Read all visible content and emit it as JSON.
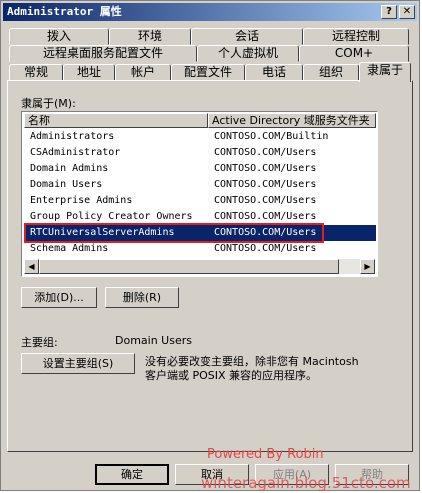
{
  "window": {
    "title": "Administrator 属性",
    "help_btn": "?",
    "close_btn": "✕"
  },
  "tabs": {
    "row1": [
      "拨入",
      "环境",
      "会话",
      "远程控制"
    ],
    "row2": [
      "远程桌面服务配置文件",
      "个人虚拟机",
      "COM+"
    ],
    "row3": [
      "常规",
      "地址",
      "帐户",
      "配置文件",
      "电话",
      "组织",
      "隶属于"
    ]
  },
  "member_of": {
    "label": "隶属于(M):",
    "columns": [
      "名称",
      "Active Directory 域服务文件夹"
    ],
    "rows": [
      {
        "name": "Administrators",
        "folder": "CONTOSO.COM/Builtin"
      },
      {
        "name": "CSAdministrator",
        "folder": "CONTOSO.COM/Users"
      },
      {
        "name": "Domain Admins",
        "folder": "CONTOSO.COM/Users"
      },
      {
        "name": "Domain Users",
        "folder": "CONTOSO.COM/Users"
      },
      {
        "name": "Enterprise Admins",
        "folder": "CONTOSO.COM/Users"
      },
      {
        "name": "Group Policy Creator Owners",
        "folder": "CONTOSO.COM/Users"
      },
      {
        "name": "RTCUniversalServerAdmins",
        "folder": "CONTOSO.COM/Users",
        "selected": true
      },
      {
        "name": "Schema Admins",
        "folder": "CONTOSO.COM/Users"
      }
    ],
    "scroll_left_icon": "left-arrow-icon",
    "scroll_right_icon": "right-arrow-icon"
  },
  "buttons": {
    "add": "添加(D)...",
    "remove": "删除(R)",
    "set_primary": "设置主要组(S)"
  },
  "primary_group": {
    "label": "主要组:",
    "value": "Domain Users",
    "note_line1": "没有必要改变主要组，除非您有 Macintosh",
    "note_line2": "客户端或 POSIX 兼容的应用程序。"
  },
  "footer": {
    "ok": "确定",
    "cancel": "取消",
    "apply": "应用(A)",
    "help": "帮助"
  },
  "watermark": {
    "line1": "Powered By Robin",
    "line2": "winteragain.blog.51cto.com"
  }
}
